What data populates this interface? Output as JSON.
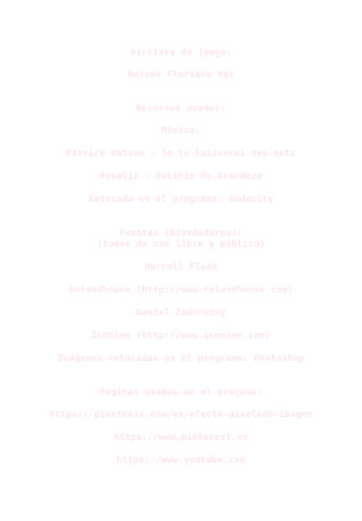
{
  "credits": {
    "direction_heading": "Dirctora de juego:",
    "director_name": "Naizea Floriano Vaz",
    "resources_heading": "Recursos usados:",
    "music_heading": "Música:",
    "music_1": "Patrick Watson - Je te laisserai des mots",
    "music_2": "Rosalía - Delirio De Grandeza",
    "music_note": "Retocada en el programa: Audacity",
    "fonts_heading": "Fuentes (Diseñadores):",
    "fonts_subheading": "(todas de uso libre y público)",
    "font_1": "Darrell Flood",
    "font_2": "Rolandhouse (http://www.rolandhouse.com)",
    "font_3": "Daniel Zadorozny",
    "font_4": "Iconian (http://www.iconian.com)",
    "images_note": "Imágenes retocadas en el programa: Photoshop",
    "pages_heading": "Páginas usadas en el proceso:",
    "page_1": "https://pinetnois.com/es/efecto-pixelado-imagen",
    "page_2": "https://www.pinterest.es",
    "page_3": "https://www.youtube.com"
  },
  "colors": {
    "background": "#ffffff",
    "text": "#ffe6ec"
  }
}
